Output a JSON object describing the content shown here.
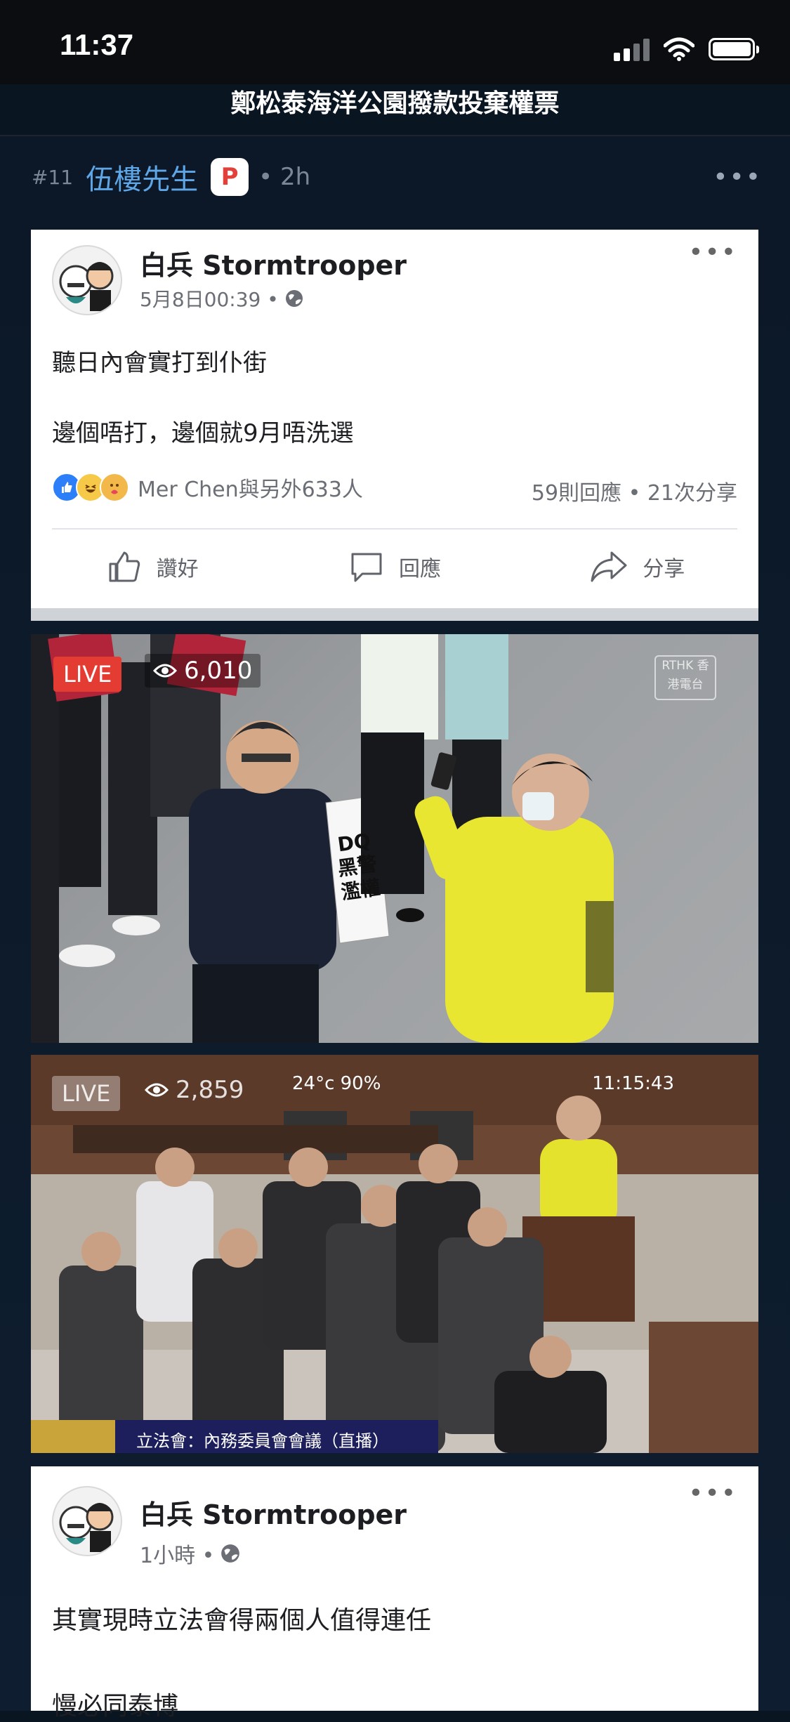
{
  "status_bar": {
    "time": "11:37"
  },
  "nav": {
    "title": "鄭松泰海洋公園撥款投棄權票"
  },
  "post": {
    "number": "#11",
    "author": "伍樓先生",
    "badge": "P",
    "age": "• 2h",
    "more": "•••"
  },
  "fb_post_1": {
    "name": "白兵 Stormtrooper",
    "meta": "5月8日00:39 •",
    "more": "•••",
    "line1": "聽日內會實打到仆街",
    "line2": "邊個唔打，邊個就9月唔洗選",
    "reaction_names": "Mer Chen與另外633人",
    "counts": "59則回應 • 21次分享",
    "actions": {
      "like": "讚好",
      "comment": "回應",
      "share": "分享"
    }
  },
  "photo_1": {
    "live": "LIVE",
    "viewers": "6,010",
    "watermark": "RTHK 香港電台",
    "sign_text": "DQ 黑警 濫權"
  },
  "photo_2": {
    "live": "LIVE",
    "viewers": "2,859",
    "weather": "24°c 90%",
    "clock": "11:15:43",
    "caption": "立法會：內務委員會會議（直播）"
  },
  "fb_post_2": {
    "name": "白兵 Stormtrooper",
    "meta": "1小時 •",
    "more": "•••",
    "line1": "其實現時立法會得兩個人值得連任",
    "line2": "慢必同泰博"
  },
  "colors": {
    "background": "#0a1522",
    "link_blue": "#5fa6e6",
    "live_red": "#e43b33",
    "fb_blue": "#2d7ff9"
  }
}
